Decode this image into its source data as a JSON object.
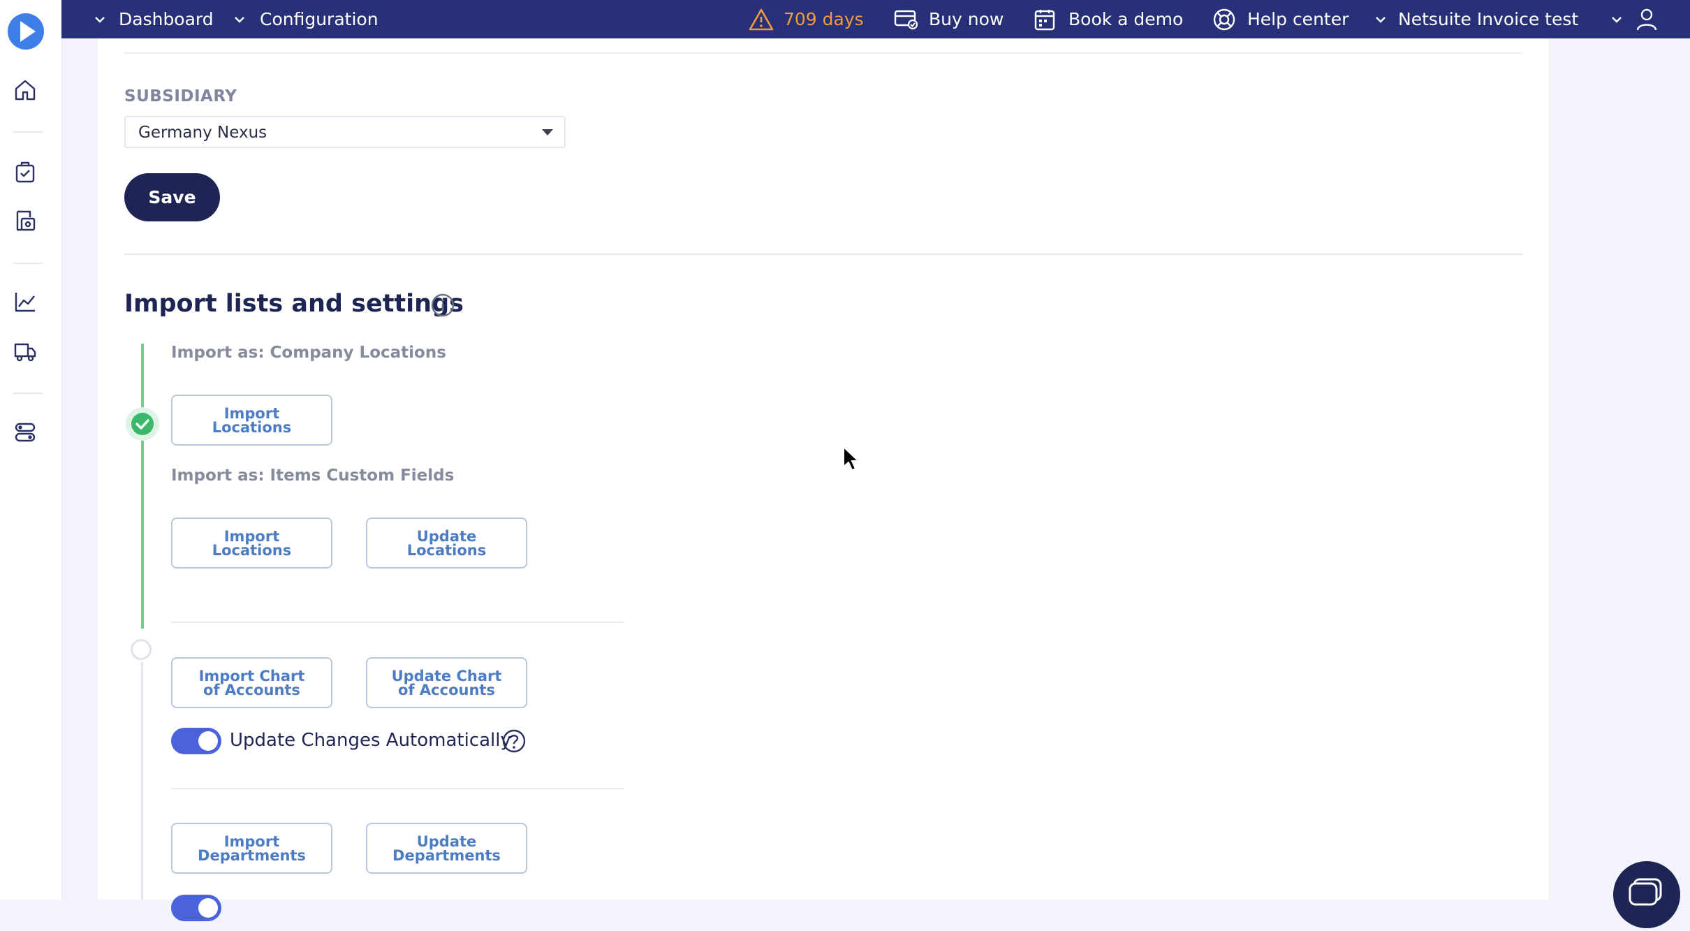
{
  "topbar": {
    "nav": [
      "Dashboard",
      "Configuration"
    ],
    "trial_days": "709 days",
    "buy_now": "Buy now",
    "book_demo": "Book a demo",
    "help_center": "Help center",
    "account": "Netsuite Invoice test"
  },
  "subsidiary": {
    "label": "SUBSIDIARY",
    "value": "Germany Nexus"
  },
  "save_label": "Save",
  "import_section": {
    "title": "Import lists and settings",
    "group1_label": "Import as: Company Locations",
    "group1_buttons": [
      "Import\nLocations"
    ],
    "group2_label": "Import as: Items Custom Fields",
    "group2_buttons": [
      "Import\nLocations",
      "Update\nLocations"
    ],
    "accounts_buttons": [
      "Import Chart\nof Accounts",
      "Update Chart\nof Accounts"
    ],
    "toggle_label": "Update Changes Automatically",
    "toggle_on": true,
    "departments_buttons": [
      "Import\nDepartments",
      "Update\nDepartments"
    ]
  },
  "colors": {
    "topbar": "#283078",
    "primary_button": "#1e2453",
    "step_done": "#3cb86a",
    "toggle_on": "#4a62dc",
    "warning": "#f19a3e"
  }
}
